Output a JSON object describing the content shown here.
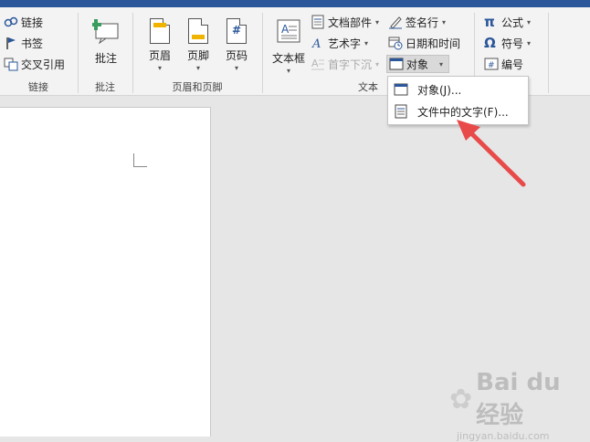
{
  "ribbon": {
    "groups": {
      "links": {
        "label": "链接",
        "items": [
          "链接",
          "书签",
          "交叉引用"
        ]
      },
      "comments": {
        "label": "批注",
        "button": "批注"
      },
      "header_footer": {
        "label": "页眉和页脚",
        "buttons": [
          "页眉",
          "页脚",
          "页码"
        ]
      },
      "text": {
        "label": "文本",
        "textbox": "文本框",
        "quick_parts": "文档部件",
        "wordart": "艺术字",
        "dropcap": "首字下沉",
        "signature_line": "签名行",
        "date_time": "日期和时间",
        "object": "对象"
      },
      "symbols": {
        "equation": "公式",
        "symbol": "符号",
        "number": "编号"
      }
    }
  },
  "object_menu": {
    "items": [
      "对象(J)...",
      "文件中的文字(F)..."
    ]
  },
  "watermark": {
    "brand": "Bai du 经验",
    "url": "jingyan.baidu.com"
  },
  "colors": {
    "title_bar": "#2b579a",
    "arrow": "#e84a4a",
    "highlight": "#d9d9d9"
  }
}
